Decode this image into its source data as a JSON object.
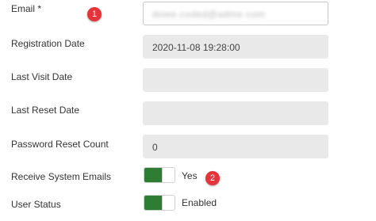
{
  "fields": {
    "email": {
      "label": "Email *",
      "value": "dowe.coded@adme.com"
    },
    "registration_date": {
      "label": "Registration Date",
      "value": "2020-11-08 19:28:00"
    },
    "last_visit_date": {
      "label": "Last Visit Date",
      "value": ""
    },
    "last_reset_date": {
      "label": "Last Reset Date",
      "value": ""
    },
    "password_reset_count": {
      "label": "Password Reset Count",
      "value": "0"
    },
    "receive_system_emails": {
      "label": "Receive System Emails",
      "value": "Yes",
      "on": true
    },
    "user_status": {
      "label": "User Status",
      "value": "Enabled",
      "on": true
    }
  },
  "markers": {
    "one": "1",
    "two": "2"
  },
  "colors": {
    "toggle_on": "#2e7d32",
    "marker": "#e5333a",
    "readonly_bg": "#e9e9e9"
  }
}
